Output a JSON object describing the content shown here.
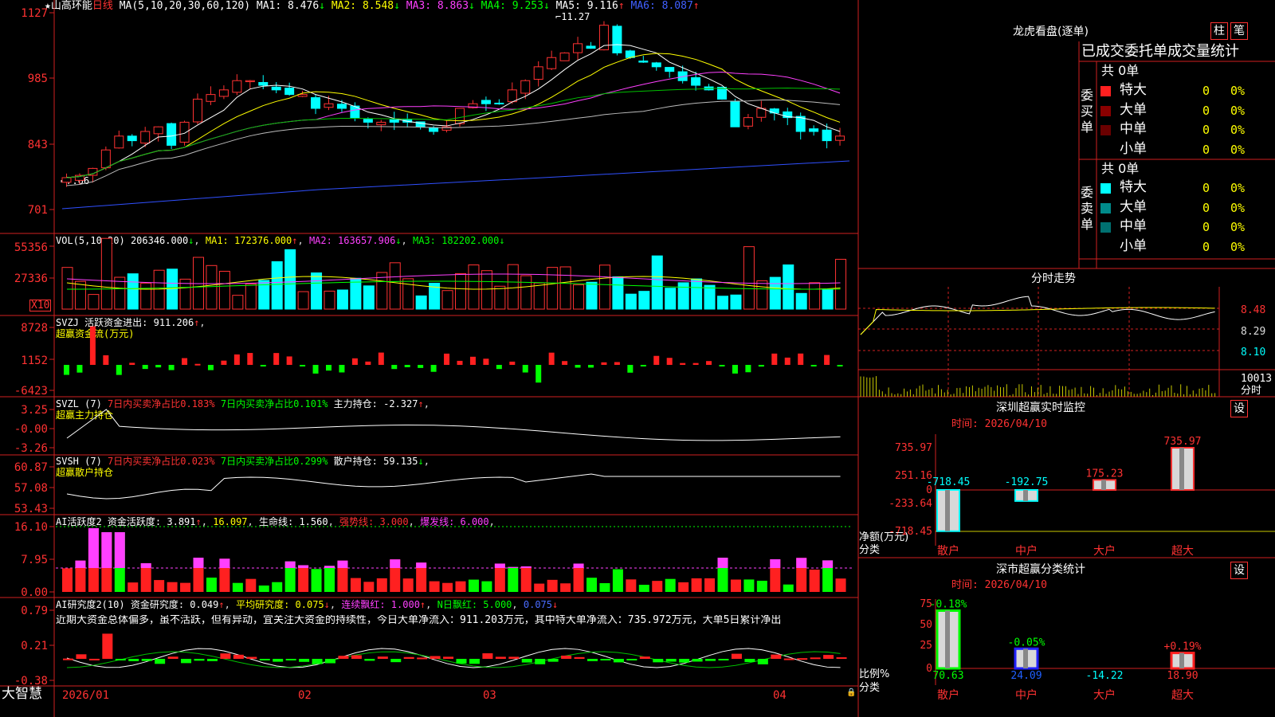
{
  "stock": {
    "name": "山高环能",
    "period": "日线"
  },
  "main": {
    "ma_header": "MA(5,10,20,30,60,120)",
    "mas": [
      {
        "label": "MA1:",
        "value": "8.476",
        "arrow": "↓",
        "color": "#ffffff"
      },
      {
        "label": "MA2:",
        "value": "8.548",
        "arrow": "↓",
        "color": "#ffff00"
      },
      {
        "label": "MA3:",
        "value": "8.863",
        "arrow": "↓",
        "color": "#ff40ff"
      },
      {
        "label": "MA4:",
        "value": "9.253",
        "arrow": "↓",
        "color": "#00ff00"
      },
      {
        "label": "MA5:",
        "value": "9.116",
        "arrow": "↑",
        "color": "#ffffff"
      },
      {
        "label": "MA6:",
        "value": "8.087",
        "arrow": "↑",
        "color": "#4060ff"
      }
    ],
    "high_label": "11.27",
    "low_label": "7.66",
    "y_ticks": [
      "1127",
      "985",
      "843",
      "701"
    ]
  },
  "vol": {
    "header": "VOL(5,10,20)",
    "value": "206346.000",
    "arrow": "↓",
    "ma1": "MA1: 172376.000",
    "ma1_arrow": "↑",
    "ma2": "MA2: 163657.906",
    "ma2_arrow": "↓",
    "ma3": "MA3: 182202.000",
    "ma3_arrow": "↓",
    "y_ticks": [
      "55356",
      "27336"
    ],
    "unit": "X10"
  },
  "svzj": {
    "header": "SVZJ",
    "label": "活跃资金进出:",
    "value": "911.206",
    "arrow": "↑",
    "sub": "超赢资金流(万元)",
    "y_ticks": [
      "8728",
      "1152",
      "-6423"
    ]
  },
  "svzl": {
    "header": "SVZL (7)",
    "t1": "7日内买卖净占比0.183%",
    "t2": "7日内买卖净占比0.101%",
    "t3": "主力持仓: -2.327",
    "arrow": "↑",
    "sub": "超赢主力持仓",
    "y_ticks": [
      "3.25",
      "-0.00",
      "-3.26"
    ]
  },
  "svsh": {
    "header": "SVSH (7)",
    "t1": "7日内买卖净占比0.023%",
    "t2": "7日内买卖净占比0.299%",
    "t3": "散户持仓: 59.135",
    "arrow": "↓",
    "sub": "超赢散户持仓",
    "y_ticks": [
      "60.87",
      "57.08",
      "53.43"
    ]
  },
  "ai1": {
    "header": "AI活跃度2",
    "l1": "资金活跃度: 3.891",
    "a1": "↑",
    "l2": "16.097",
    "l3": "生命线: 1.560",
    "l4": "强势线: 3.000",
    "l5": "爆发线: 6.000",
    "y_ticks": [
      "16.10",
      "7.95",
      "0.00"
    ]
  },
  "ai2": {
    "header": "AI研究度2(10)",
    "l1": "资金研究度: 0.049",
    "a1": "↑",
    "l2": "平均研究度: 0.075",
    "a2": "↓",
    "l3": "连续飘红: 1.000",
    "a3": "↑",
    "l4": "N日飘红: 5.000",
    "l5": "0.075",
    "a5": "↓",
    "comment": "近期大资金总体偏多，虽不活跃，但有异动，宜关注大资金的持续性，今日大单净流入：911.203万元，其中特大单净流入：735.972万元，大单5日累计净出",
    "y_ticks": [
      "0.79",
      "0.21",
      "-0.38"
    ]
  },
  "dates": [
    "2026/01",
    "02",
    "03",
    "04"
  ],
  "brand": "大智慧",
  "right": {
    "lhb": {
      "title": "龙虎看盘(逐单)",
      "btn1": "柱",
      "btn2": "笔",
      "tabs": "已成交委托单成交量统计",
      "buy": {
        "side": "委买单",
        "total": "共 0单",
        "rows": [
          {
            "name": "特大",
            "v": "0",
            "p": "0%",
            "color": "#ff2020"
          },
          {
            "name": "大单",
            "v": "0",
            "p": "0%",
            "color": "#8a0000"
          },
          {
            "name": "中单",
            "v": "0",
            "p": "0%",
            "color": "#6a0000"
          },
          {
            "name": "小单",
            "v": "0",
            "p": "0%",
            "color": "#000000"
          }
        ]
      },
      "sell": {
        "side": "委卖单",
        "total": "共 0单",
        "rows": [
          {
            "name": "特大",
            "v": "0",
            "p": "0%",
            "color": "#00ffff"
          },
          {
            "name": "大单",
            "v": "0",
            "p": "0%",
            "color": "#008a8a"
          },
          {
            "name": "中单",
            "v": "0",
            "p": "0%",
            "color": "#007070"
          },
          {
            "name": "小单",
            "v": "0",
            "p": "0%",
            "color": "#000000"
          }
        ]
      }
    },
    "intraday": {
      "title": "分时走势",
      "y_ticks": [
        "8.48",
        "8.29",
        "8.10"
      ],
      "vol_tick": "10013",
      "vol_unit": "分时"
    },
    "sz": {
      "title": "深圳超赢实时监控",
      "btn": "设",
      "time": "时间: 2026/04/10",
      "y_ticks": [
        "735.97",
        "251.16",
        "0",
        "-233.64",
        "-718.45"
      ],
      "ylab1": "净额(万元)",
      "ylab2": "分类",
      "cats": [
        "散户",
        "中户",
        "大户",
        "超大"
      ],
      "values": [
        -718.45,
        -192.75,
        175.23,
        735.97
      ],
      "labels": [
        "-718.45",
        "-192.75",
        "175.23",
        "735.97"
      ]
    },
    "ss": {
      "title": "深市超赢分类统计",
      "btn": "设",
      "time": "时间: 2026/04/10",
      "y_ticks": [
        "75",
        "50",
        "25",
        "0"
      ],
      "ylab1": "比例%",
      "ylab2": "分类",
      "cats": [
        "散户",
        "中户",
        "大户",
        "超大"
      ],
      "values": [
        70.63,
        24.09,
        -14.22,
        18.9
      ],
      "labels": [
        "70.63",
        "24.09",
        "-14.22",
        "18.90"
      ],
      "pct": [
        "-0.18%",
        "-0.05%",
        "",
        "+0.19%"
      ]
    }
  },
  "chart_data": [
    {
      "type": "bar",
      "title": "深圳超赢实时监控",
      "categories": [
        "散户",
        "中户",
        "大户",
        "超大"
      ],
      "values": [
        -718.45,
        -192.75,
        175.23,
        735.97
      ],
      "ylabel": "净额(万元)",
      "ylim": [
        -718.45,
        735.97
      ]
    },
    {
      "type": "bar",
      "title": "深市超赢分类统计",
      "categories": [
        "散户",
        "中户",
        "大户",
        "超大"
      ],
      "values": [
        70.63,
        24.09,
        -14.22,
        18.9
      ],
      "ylabel": "比例%",
      "ylim": [
        0,
        75
      ]
    }
  ]
}
